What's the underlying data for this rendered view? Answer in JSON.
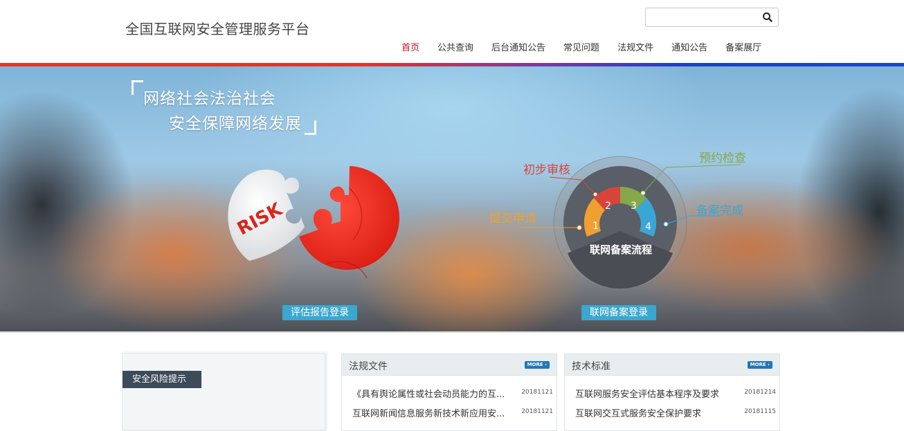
{
  "header": {
    "site_title": "全国互联网安全管理服务平台",
    "search_placeholder": "",
    "search_icon": "search-icon"
  },
  "nav": {
    "items": [
      {
        "label": "首页",
        "active": true
      },
      {
        "label": "公共查询"
      },
      {
        "label": "后台通知公告"
      },
      {
        "label": "常见问题"
      },
      {
        "label": "法规文件"
      },
      {
        "label": "通知公告"
      },
      {
        "label": "备案展厅"
      }
    ]
  },
  "banner": {
    "slogan_line1": "网络社会法治社会",
    "slogan_line2": "安全保障网络发展",
    "puzzle_text": "RISK",
    "assess_button": "评估报告登录",
    "filing_button": "联网备案登录",
    "process": {
      "center": "联网备案流程",
      "steps": [
        {
          "num": "1",
          "label": "提交申请",
          "color": "#f0a030"
        },
        {
          "num": "2",
          "label": "初步审核",
          "color": "#d9443a"
        },
        {
          "num": "3",
          "label": "预约检查",
          "color": "#86a84a"
        },
        {
          "num": "4",
          "label": "备案完成",
          "color": "#3aa6d6"
        }
      ]
    }
  },
  "risk_tips": {
    "label": "安全风险提示"
  },
  "panels": {
    "laws": {
      "title": "法规文件",
      "more": "MORE",
      "items": [
        {
          "title": "《具有舆论属性或社会动员能力的互...",
          "date": "20181121"
        },
        {
          "title": "互联网新闻信息服务新技术新应用安...",
          "date": "20181121"
        }
      ]
    },
    "standards": {
      "title": "技术标准",
      "more": "MORE",
      "items": [
        {
          "title": "互联网服务安全评估基本程序及要求",
          "date": "20181214"
        },
        {
          "title": "互联网交互式服务安全保护要求",
          "date": "20181115"
        }
      ]
    }
  }
}
